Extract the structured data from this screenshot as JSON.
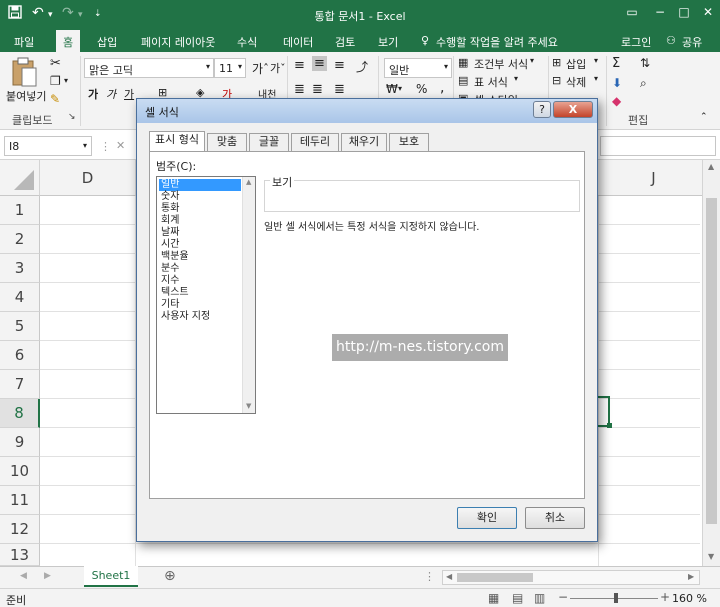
{
  "window": {
    "title": "통합 문서1 - Excel",
    "accent": "#217346"
  },
  "quick_access": {
    "save_icon": "save-icon",
    "undo_icon": "undo-icon",
    "redo_icon": "redo-icon",
    "customize_icon": "customize-icon"
  },
  "window_controls": [
    "restore-icon",
    "minimize-icon",
    "maximize-icon",
    "close-icon"
  ],
  "tabs": {
    "file": "파일",
    "home": "홈",
    "insert": "삽입",
    "layout": "페이지 레이아웃",
    "formulas": "수식",
    "data": "데이터",
    "review": "검토",
    "view": "보기",
    "tell": "수행할 작업을 알려 주세요",
    "login": "로그인",
    "share": "공유"
  },
  "ribbon": {
    "paste": "붙여넣기",
    "clipboard": "클립보드",
    "font_name": "맑은 고딕",
    "font_size": "11",
    "bold": "가",
    "italic": "가",
    "underline": "가",
    "number_format": "일반",
    "percent": "%",
    "comma": ",",
    "cond_format": "조건부 서식",
    "table_format": "표 서식",
    "cell_style": "셀 스타일",
    "insert": "삽입",
    "delete": "삭제",
    "editing": "편집"
  },
  "formula_bar": {
    "name_box": "I8"
  },
  "grid": {
    "columns": [
      "D",
      "J"
    ],
    "rows": [
      "1",
      "2",
      "3",
      "4",
      "5",
      "6",
      "7",
      "8",
      "9",
      "10",
      "11",
      "12",
      "13"
    ],
    "active_row": "8"
  },
  "sheet": {
    "tab": "Sheet1"
  },
  "status": {
    "ready": "준비",
    "zoom": "160 %"
  },
  "dialog": {
    "title": "셀 서식",
    "help": "?",
    "close": "X",
    "tabs": [
      "표시 형식",
      "맞춤",
      "글꼴",
      "테두리",
      "채우기",
      "보호"
    ],
    "category_label": "범주(C):",
    "categories": [
      "일반",
      "숫자",
      "통화",
      "회계",
      "날짜",
      "시간",
      "백분율",
      "분수",
      "지수",
      "텍스트",
      "기타",
      "사용자 지정"
    ],
    "selected_category": "일반",
    "sample_label": "보기",
    "description": "일반 셀 서식에서는 특정 서식을 지정하지 않습니다.",
    "ok": "확인",
    "cancel": "취소"
  },
  "watermark": "http://m-nes.tistory.com"
}
